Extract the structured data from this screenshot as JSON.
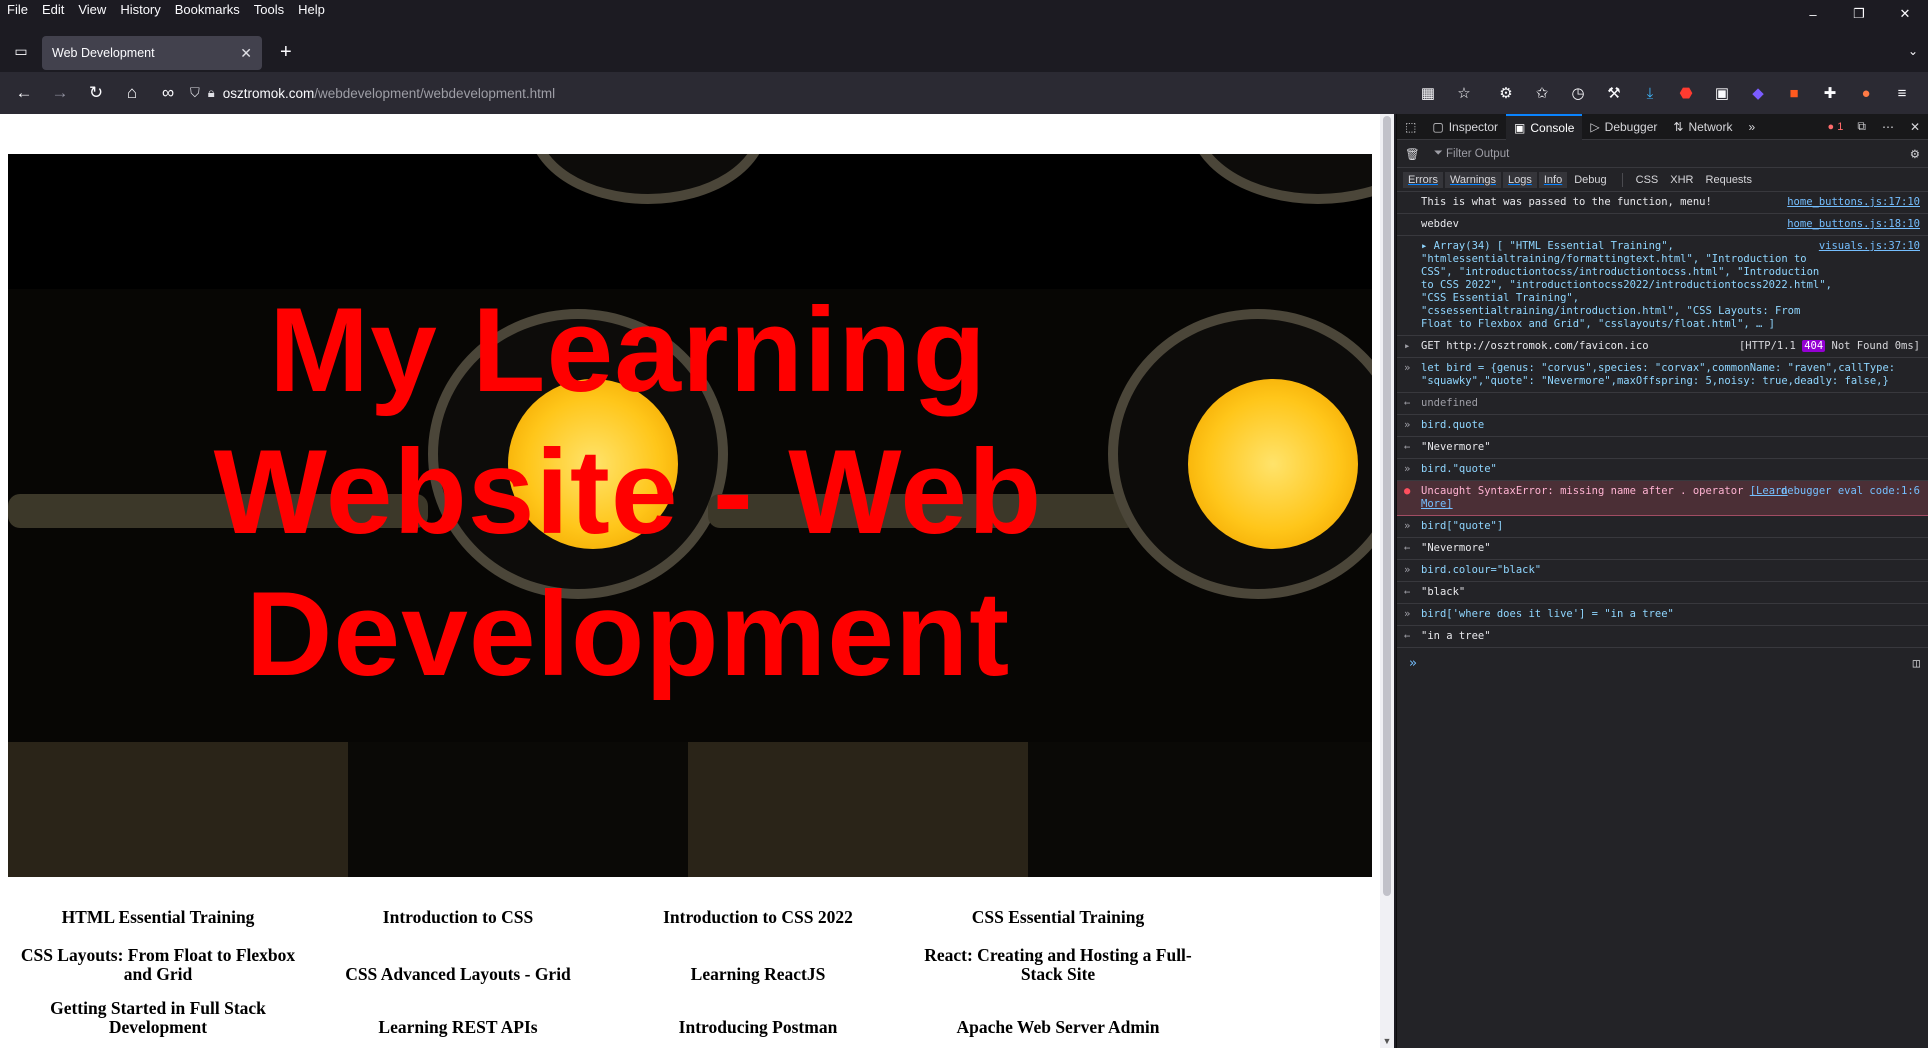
{
  "menubar": {
    "items": [
      "File",
      "Edit",
      "View",
      "History",
      "Bookmarks",
      "Tools",
      "Help"
    ]
  },
  "window": {
    "minimize": "–",
    "restore": "❐",
    "close": "✕"
  },
  "tabs": [
    {
      "title": "Web Development"
    }
  ],
  "navbar": {
    "url_host": "osztromok.com",
    "url_path": "/webdevelopment/webdevelopment.html"
  },
  "page": {
    "hero_title": "My Learning Website - Web Development",
    "courses": [
      "HTML Essential Training",
      "Introduction to CSS",
      "Introduction to CSS 2022",
      "CSS Essential Training",
      "CSS Layouts: From Float to Flexbox and Grid",
      "CSS Advanced Layouts - Grid",
      "Learning ReactJS",
      "React: Creating and Hosting a Full-Stack Site",
      "Getting Started in Full Stack Development",
      "Learning REST APIs",
      "Introducing Postman",
      "Apache Web Server Admin"
    ],
    "colors": {
      "title": "#ff0000",
      "background": "#ffffff"
    }
  },
  "devtools": {
    "tabs": [
      "Inspector",
      "Console",
      "Debugger",
      "Network"
    ],
    "active_tab": "Console",
    "error_count": "1",
    "filter_placeholder": "Filter Output",
    "levels": [
      "Errors",
      "Warnings",
      "Logs",
      "Info",
      "Debug"
    ],
    "extra_filters": [
      "CSS",
      "XHR",
      "Requests"
    ],
    "messages": [
      {
        "text": "This is what was passed to the function, menu!",
        "source": "home_buttons.js:17:10"
      },
      {
        "text": "webdev",
        "source": "home_buttons.js:18:10"
      },
      {
        "text": "▸ Array(34) [ \"HTML Essential Training\", \"htmlessentialtraining/formattingtext.html\", \"Introduction to CSS\", \"introductiontocss/introductiontocss.html\", \"Introduction to CSS 2022\", \"introductiontocss2022/introductiontocss2022.html\", \"CSS Essential Training\", \"cssessentialtraining/introduction.html\", \"CSS Layouts: From Float to Flexbox and Grid\", \"csslayouts/float.html\", … ]",
        "source": "visuals.js:37:10"
      },
      {
        "text": "GET http://osztromok.com/favicon.ico",
        "source_prefix": "[HTTP/1.1 ",
        "status": "404",
        "source_suffix": " Not Found 0ms]"
      },
      {
        "text": "let bird = {genus: \"corvus\",species: \"corvax\",commonName: \"raven\",callType: \"squawky\",\"quote\": \"Nevermore\",maxOffspring: 5,noisy: true,deadly: false,}"
      },
      {
        "text": "undefined"
      },
      {
        "text": "bird.quote"
      },
      {
        "text": "\"Nevermore\""
      },
      {
        "text": "bird.\"quote\""
      },
      {
        "text": "Uncaught SyntaxError: missing name after . operator",
        "link": "[Learn More]",
        "source": "debugger eval code:1:6"
      },
      {
        "text": "bird[\"quote\"]"
      },
      {
        "text": "\"Nevermore\""
      },
      {
        "text": "bird.colour=\"black\""
      },
      {
        "text": "\"black\""
      },
      {
        "text": "bird['where does it live'] = \"in a tree\""
      },
      {
        "text": "\"in a tree\""
      }
    ]
  }
}
